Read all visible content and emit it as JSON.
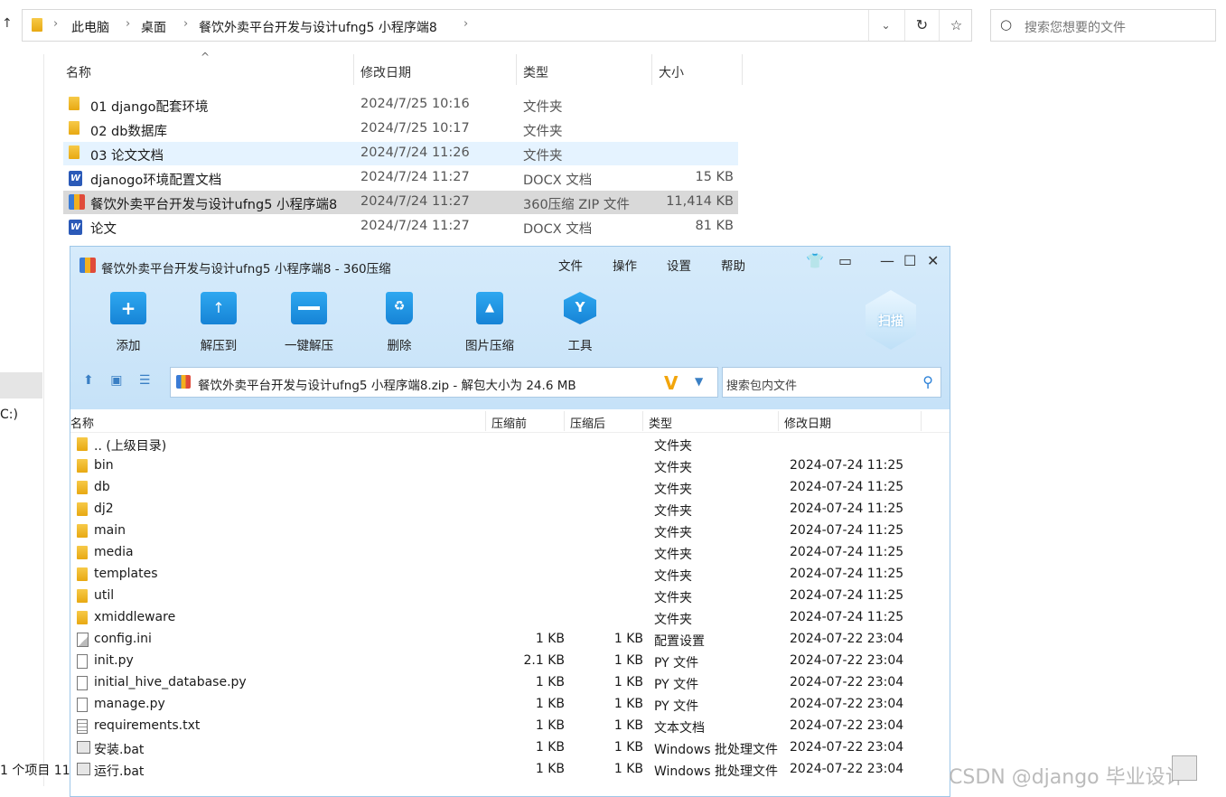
{
  "explorer": {
    "breadcrumb": [
      "此电脑",
      "桌面",
      "餐饮外卖平台开发与设计ufng5 小程序端8"
    ],
    "search_placeholder": "搜索您想要的文件",
    "columns": {
      "name": "名称",
      "date": "修改日期",
      "type": "类型",
      "size": "大小"
    },
    "files": [
      {
        "name": "01 django配套环境",
        "date": "2024/7/25 10:16",
        "type": "文件夹",
        "size": "",
        "icon": "folder-icon"
      },
      {
        "name": "02 db数据库",
        "date": "2024/7/25 10:17",
        "type": "文件夹",
        "size": "",
        "icon": "folder-icon"
      },
      {
        "name": "03 论文文档",
        "date": "2024/7/24 11:26",
        "type": "文件夹",
        "size": "",
        "icon": "folder-icon"
      },
      {
        "name": "djanogo环境配置文档",
        "date": "2024/7/24 11:27",
        "type": "DOCX 文档",
        "size": "15 KB",
        "icon": "word-icon"
      },
      {
        "name": "餐饮外卖平台开发与设计ufng5 小程序端8",
        "date": "2024/7/24 11:27",
        "type": "360压缩 ZIP 文件",
        "size": "11,414 KB",
        "icon": "zip-icon"
      },
      {
        "name": "论文",
        "date": "2024/7/24 11:27",
        "type": "DOCX 文档",
        "size": "81 KB",
        "icon": "word-icon"
      }
    ],
    "nav_drive": "C:)",
    "status": "1 个项目  11"
  },
  "zipwin": {
    "title": "餐饮外卖平台开发与设计ufng5 小程序端8 - 360压缩",
    "menu": [
      "文件",
      "操作",
      "设置",
      "帮助"
    ],
    "tools": [
      "添加",
      "解压到",
      "一键解压",
      "删除",
      "图片压缩",
      "工具"
    ],
    "scan_label": "扫描",
    "path": "餐饮外卖平台开发与设计ufng5 小程序端8.zip - 解包大小为 24.6 MB",
    "search_placeholder": "搜索包内文件",
    "columns": {
      "name": "名称",
      "before": "压缩前",
      "after": "压缩后",
      "type": "类型",
      "date": "修改日期"
    },
    "rows": [
      {
        "name": ".. (上级目录)",
        "before": "",
        "after": "",
        "type": "文件夹",
        "date": "",
        "icon": "folder-icon"
      },
      {
        "name": "bin",
        "before": "",
        "after": "",
        "type": "文件夹",
        "date": "2024-07-24 11:25",
        "icon": "folder-icon"
      },
      {
        "name": "db",
        "before": "",
        "after": "",
        "type": "文件夹",
        "date": "2024-07-24 11:25",
        "icon": "folder-icon"
      },
      {
        "name": "dj2",
        "before": "",
        "after": "",
        "type": "文件夹",
        "date": "2024-07-24 11:25",
        "icon": "folder-icon"
      },
      {
        "name": "main",
        "before": "",
        "after": "",
        "type": "文件夹",
        "date": "2024-07-24 11:25",
        "icon": "folder-icon"
      },
      {
        "name": "media",
        "before": "",
        "after": "",
        "type": "文件夹",
        "date": "2024-07-24 11:25",
        "icon": "folder-icon"
      },
      {
        "name": "templates",
        "before": "",
        "after": "",
        "type": "文件夹",
        "date": "2024-07-24 11:25",
        "icon": "folder-icon"
      },
      {
        "name": "util",
        "before": "",
        "after": "",
        "type": "文件夹",
        "date": "2024-07-24 11:25",
        "icon": "folder-icon"
      },
      {
        "name": "xmiddleware",
        "before": "",
        "after": "",
        "type": "文件夹",
        "date": "2024-07-24 11:25",
        "icon": "folder-icon"
      },
      {
        "name": "config.ini",
        "before": "1 KB",
        "after": "1 KB",
        "type": "配置设置",
        "date": "2024-07-22 23:04",
        "icon": "ini-file-icon"
      },
      {
        "name": "init.py",
        "before": "2.1 KB",
        "after": "1 KB",
        "type": "PY 文件",
        "date": "2024-07-22 23:04",
        "icon": "file-icon"
      },
      {
        "name": "initial_hive_database.py",
        "before": "1 KB",
        "after": "1 KB",
        "type": "PY 文件",
        "date": "2024-07-22 23:04",
        "icon": "file-icon"
      },
      {
        "name": "manage.py",
        "before": "1 KB",
        "after": "1 KB",
        "type": "PY 文件",
        "date": "2024-07-22 23:04",
        "icon": "file-icon"
      },
      {
        "name": "requirements.txt",
        "before": "1 KB",
        "after": "1 KB",
        "type": "文本文档",
        "date": "2024-07-22 23:04",
        "icon": "text-file-icon"
      },
      {
        "name": "安装.bat",
        "before": "1 KB",
        "after": "1 KB",
        "type": "Windows 批处理文件",
        "date": "2024-07-22 23:04",
        "icon": "bat-file-icon"
      },
      {
        "name": "运行.bat",
        "before": "1 KB",
        "after": "1 KB",
        "type": "Windows 批处理文件",
        "date": "2024-07-22 23:04",
        "icon": "bat-file-icon"
      }
    ]
  },
  "watermark": "CSDN @django  毕业设计"
}
